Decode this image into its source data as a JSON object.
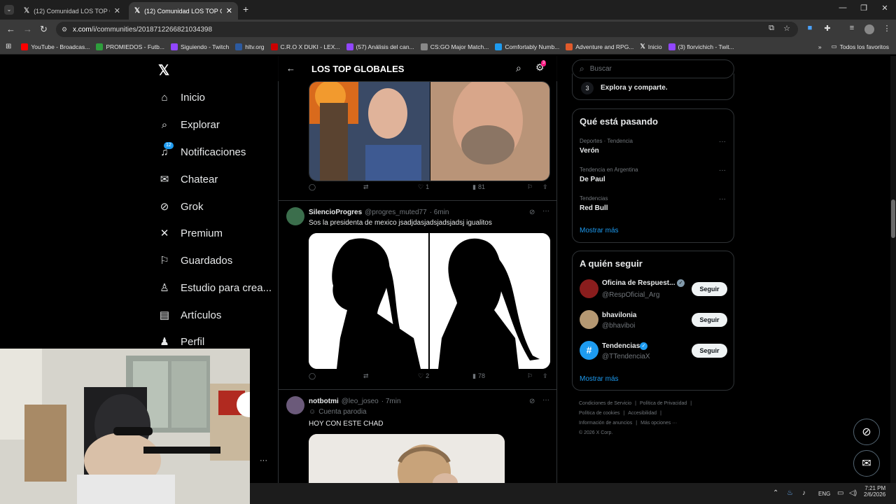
{
  "browser": {
    "tabs": [
      {
        "title": "(12) Comunidad LOS TOP GLOB..."
      },
      {
        "title": "(12) Comunidad LOS TOP GLOB..."
      }
    ],
    "url_host": "x.com",
    "url_path": "/i/communities/2018712266821034398",
    "bookmarks": [
      {
        "label": "YouTube - Broadcas...",
        "color": "#ff0000"
      },
      {
        "label": "PROMIEDOS - Futb...",
        "color": "#2e9e3c"
      },
      {
        "label": "Siguiendo - Twitch",
        "color": "#9146ff"
      },
      {
        "label": "hltv.org",
        "color": "#2c5aa0"
      },
      {
        "label": "C.R.O X DUKI - LEX...",
        "color": "#c00"
      },
      {
        "label": "(57) Análisis del can...",
        "color": "#9146ff"
      },
      {
        "label": "CS:GO Major Match...",
        "color": "#888"
      },
      {
        "label": "Comfortably Numb...",
        "color": "#1d9bf0"
      },
      {
        "label": "Adventure and RPG...",
        "color": "#e05a2b"
      },
      {
        "label": "Inicio",
        "color": "#000"
      },
      {
        "label": "(3) florvichich - Twit...",
        "color": "#9146ff"
      }
    ],
    "all_favorites": "Todos los favoritos"
  },
  "nav": {
    "items": [
      {
        "label": "Inicio",
        "icon": "home-icon",
        "glyph": "⌂"
      },
      {
        "label": "Explorar",
        "icon": "search-icon",
        "glyph": "⌕"
      },
      {
        "label": "Notificaciones",
        "icon": "bell-icon",
        "glyph": "♫"
      },
      {
        "label": "Chatear",
        "icon": "mail-icon",
        "glyph": "✉"
      },
      {
        "label": "Grok",
        "icon": "grok-icon",
        "glyph": "⊘"
      },
      {
        "label": "Premium",
        "icon": "x-premium-icon",
        "glyph": "✕"
      },
      {
        "label": "Guardados",
        "icon": "bookmark-icon",
        "glyph": "⚐"
      },
      {
        "label": "Estudio para crea...",
        "icon": "studio-icon",
        "glyph": "♙"
      },
      {
        "label": "Artículos",
        "icon": "article-icon",
        "glyph": "▤"
      },
      {
        "label": "Perfil",
        "icon": "profile-icon",
        "glyph": "♟"
      }
    ],
    "notifications_badge": "12"
  },
  "community": {
    "title": "LOS TOP GLOBALES",
    "settings_badge": "3"
  },
  "posts": [
    {
      "replies": "",
      "reposts": "",
      "likes": "1",
      "views": "81"
    },
    {
      "name": "SilencioProgres",
      "handle": "@progres_muted77",
      "time": "· 6min",
      "text": "Sos la presidenta de mexico jsadjdasjadsjadsjadsj igualitos",
      "likes": "2",
      "views": "78"
    },
    {
      "name": "notbotmi",
      "handle": "@leo_joseo",
      "time": "· 7min",
      "label": "Cuenta parodia",
      "text": "HOY CON ESTE CHAD"
    }
  ],
  "right": {
    "search_placeholder": "Buscar",
    "step": {
      "num": "3",
      "text": "Explora y comparte."
    },
    "trends_title": "Qué está pasando",
    "trends": [
      {
        "meta": "Deportes · Tendencia",
        "name": "Verón"
      },
      {
        "meta": "Tendencia en Argentina",
        "name": "De Paul"
      },
      {
        "meta": "Tendencias",
        "name": "Red Bull"
      }
    ],
    "show_more": "Mostrar más",
    "follow_title": "A quién seguir",
    "follow": [
      {
        "name": "Oficina de Respuest...",
        "handle": "@RespOficial_Arg",
        "verified": "gray"
      },
      {
        "name": "bhavilonia",
        "handle": "@bhaviboi",
        "verified": ""
      },
      {
        "name": "Tendencias",
        "handle": "@TTendenciaX",
        "verified": "blue"
      }
    ],
    "follow_button": "Seguir",
    "footer": {
      "l1": "Condiciones de Servicio",
      "l2": "Política de Privacidad",
      "l3": "Política de cookies",
      "l4": "Accesibilidad",
      "l5": "Información de anuncios",
      "l6": "Más opciones ···",
      "copy": "© 2026 X Corp."
    }
  },
  "taskbar": {
    "lang": "ENG",
    "time": "7:21 PM",
    "date": "2/6/2026"
  }
}
